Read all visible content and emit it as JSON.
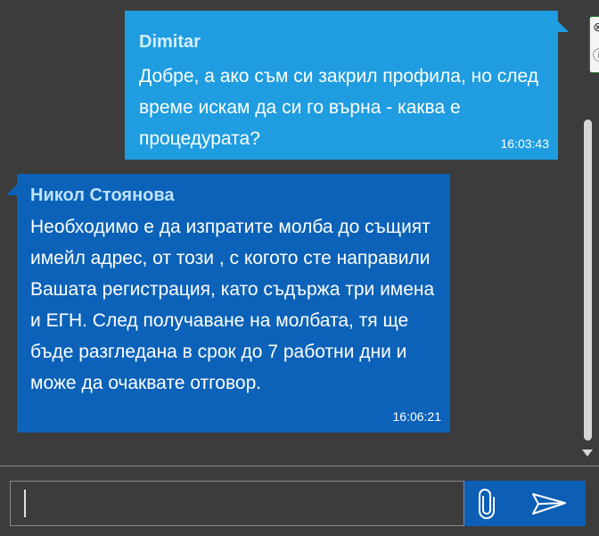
{
  "messages": [
    {
      "direction": "outgoing",
      "sender": "Dimitar",
      "text": "Добре, а ако съм си закрил профила, но след време искам да си го върна - каква е процедурата?",
      "time": "16:03:43"
    },
    {
      "direction": "incoming",
      "sender": "Никол Стоянова",
      "text": "Необходимо е да изпратите молба до същият имейл адрес, от този , с когото сте направили Вашата регистрация, като съдържа три имена и ЕГН. След получаване на молбата, тя ще бъде разгледана в срок до 7 работни дни и може да очаквате отговор.",
      "time": "16:06:21"
    }
  ],
  "composer": {
    "value": "",
    "placeholder": ""
  },
  "icons": {
    "attach": "paperclip-icon",
    "send": "send-icon",
    "edge_top": "close-icon",
    "edge_bottom": "info-icon"
  },
  "colors": {
    "background": "#3c3c3c",
    "outgoing_bubble": "#1f9de0",
    "incoming_bubble": "#0b62b8",
    "action_button": "#0c5fb4"
  }
}
